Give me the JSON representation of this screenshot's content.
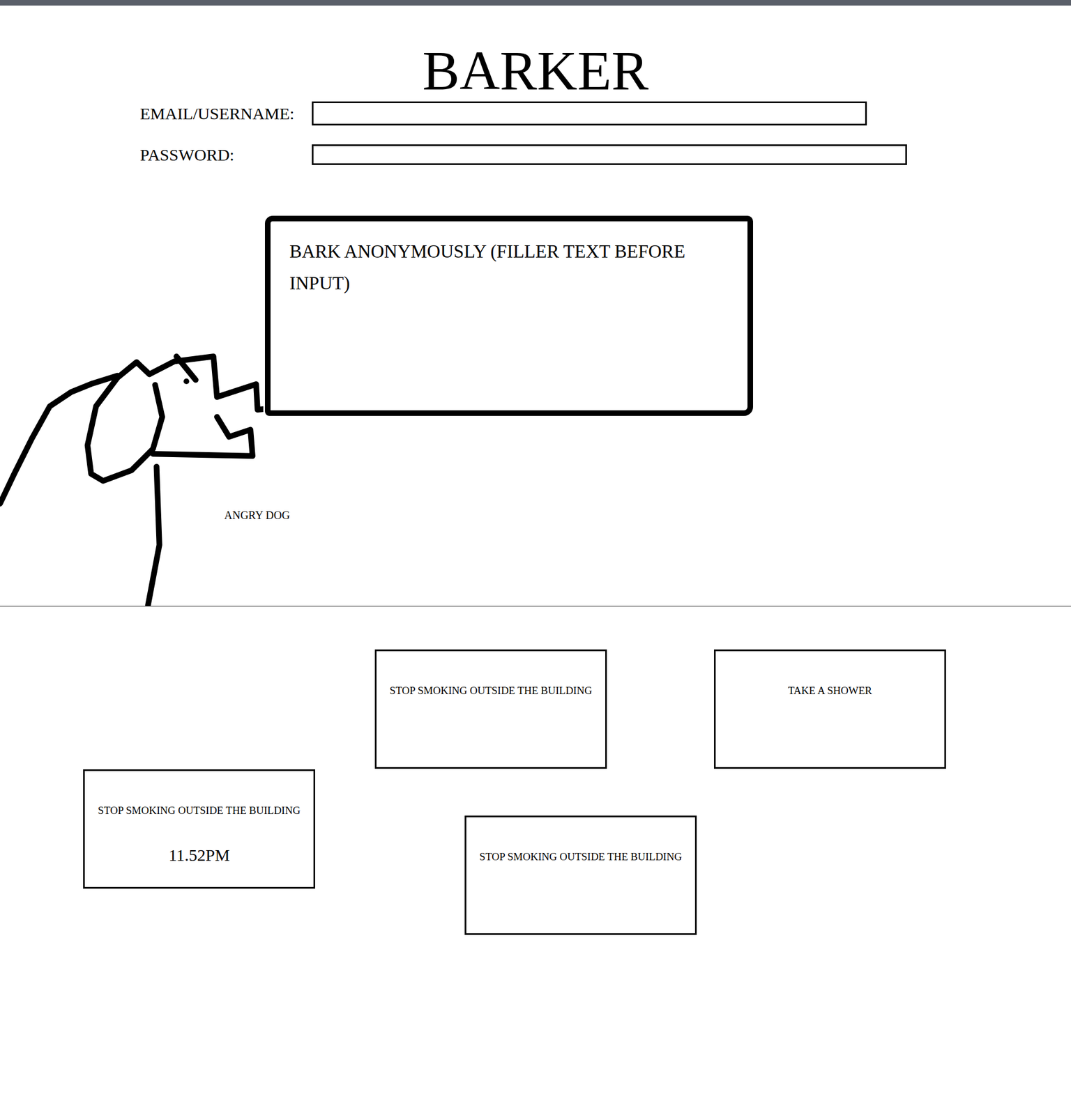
{
  "title": "BARKER",
  "form": {
    "fields": [
      {
        "label": "EMAIL/USERNAME:",
        "kind": "text"
      },
      {
        "label": "PASSWORD:",
        "kind": "password"
      }
    ]
  },
  "bark": {
    "placeholder": "BARK ANONYMOUSLY (FILLER TEXT BEFORE INPUT)"
  },
  "dog": {
    "caption": "ANGRY DOG"
  },
  "barks": [
    {
      "text": "STOP SMOKING OUTSIDE THE BUILDING"
    },
    {
      "text": "TAKE A SHOWER"
    },
    {
      "text": "STOP SMOKING OUTSIDE THE BUILDING",
      "time": "11.52PM"
    },
    {
      "text": "STOP SMOKING OUTSIDE THE BUILDING"
    }
  ]
}
